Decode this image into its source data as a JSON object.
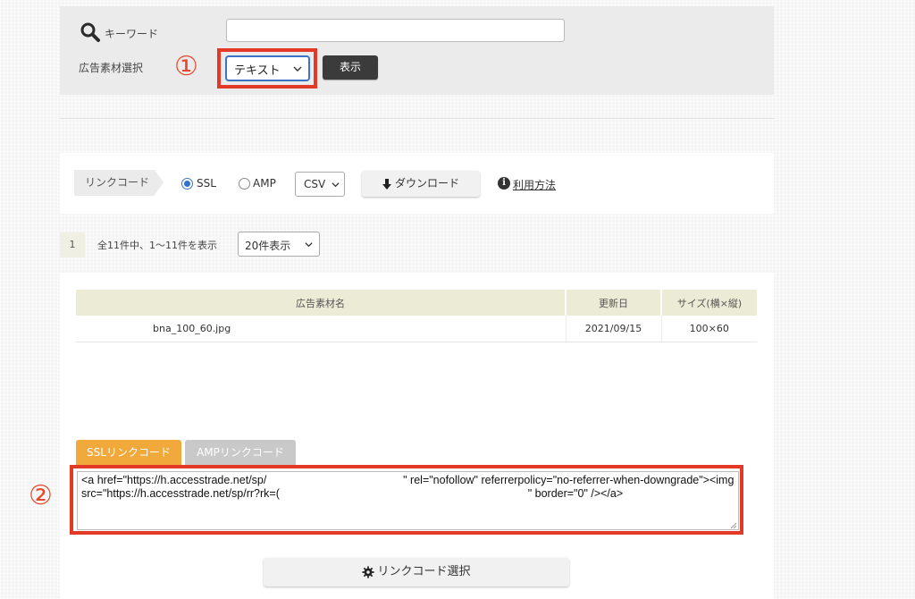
{
  "search": {
    "keyword_label": "キーワード",
    "keyword_value": "",
    "material_label": "広告素材選択",
    "material_selected": "テキスト",
    "display_button": "表示"
  },
  "annotations": {
    "one": "①",
    "two": "②"
  },
  "linkcode": {
    "tag": "リンクコード",
    "ssl_label": "SSL",
    "amp_label": "AMP",
    "selected": "SSL",
    "format_selected": "CSV",
    "download_button": "ダウンロード",
    "usage_link": "利用方法"
  },
  "pagination": {
    "current_page": "1",
    "count_text": "全11件中、1〜11件を表示",
    "per_page_selected": "20件表示"
  },
  "table": {
    "headers": [
      "広告素材名",
      "更新日",
      "サイズ(横×縦)"
    ],
    "rows": [
      [
        "bna_100_60.jpg",
        "2021/09/15",
        "100×60"
      ]
    ]
  },
  "tabs": {
    "ssl": "SSLリンクコード",
    "amp": "AMPリンクコード",
    "active": "ssl"
  },
  "code_text": "<a href=\"https://h.accesstrade.net/sp/                                            \" rel=\"nofollow\" referrerpolicy=\"no-referrer-when-downgrade\"><img src=\"https://h.accesstrade.net/sp/rr?rk=(                                                                                \" border=\"0\" /></a>",
  "select_code_button": "リンクコード選択",
  "colors": {
    "accent_red": "#e23a26",
    "tab_active": "#f0a93a",
    "tab_inactive": "#c9c9c9",
    "table_header": "#ecebd6",
    "dark_button": "#3b3b3b"
  },
  "icons": {
    "search": "search-icon",
    "download": "download-icon",
    "info": "info-icon",
    "gear": "gear-icon",
    "chevron": "chevron-down-icon"
  }
}
